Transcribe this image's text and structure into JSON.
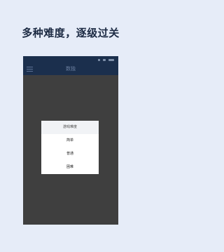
{
  "headline": "多种难度，逐级过关",
  "app": {
    "title": "数独"
  },
  "status_bar": {
    "icons": [
      "signal-icon",
      "wifi-icon",
      "battery-icon"
    ]
  },
  "dialog": {
    "title": "游戏难度",
    "options": [
      "简单",
      "普通",
      "困难"
    ]
  },
  "colors": {
    "page_background": "#e6ecf8",
    "headline": "#1c2a43",
    "app_bar": "#1b2f4d",
    "screen_overlay": "#3f3f3f",
    "dialog": "#ffffff"
  }
}
